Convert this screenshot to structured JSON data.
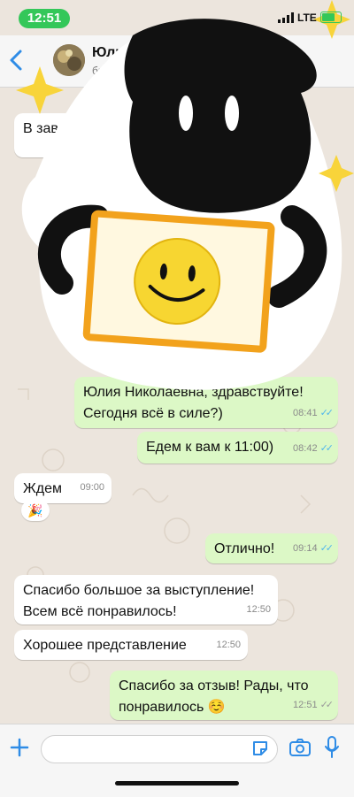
{
  "status_bar": {
    "time": "12:51",
    "network": "LTE"
  },
  "header": {
    "contact_name": "Юлия Н",
    "contact_status": "был(-а) се"
  },
  "messages": [
    {
      "side": "in",
      "text": "В зависимости о",
      "time": ""
    },
    {
      "side": "out",
      "text": "Юлия Николаевна, здравствуйте!",
      "text2": "Сегодня всё в силе?)",
      "time": "08:41"
    },
    {
      "side": "out",
      "text": "Едем к вам к 11:00)",
      "time": "08:42"
    },
    {
      "side": "in",
      "text": "Ждем",
      "time": "09:00"
    },
    {
      "side": "out",
      "text": "Отлично!",
      "time": "09:14"
    },
    {
      "side": "in",
      "text": "Спасибо большое за выступление!",
      "text2": "Всем всё понравилось!",
      "time": "12:50"
    },
    {
      "side": "in",
      "text": "Хорошее представление",
      "time": "12:50"
    },
    {
      "side": "out",
      "text": "Спасибо за отзыв! Рады, что",
      "text2": "понравилось ☺️",
      "time": "12:51"
    }
  ],
  "reaction_emoji": "🎉",
  "colors": {
    "out_bubble": "#dcf8c6",
    "in_bubble": "#ffffff",
    "accent": "#2f8ce6",
    "read_tick": "#4fb6ec"
  },
  "icons": [
    "back-chevron-icon",
    "plus-icon",
    "sticker-icon",
    "camera-icon",
    "microphone-icon",
    "smiley-sticker",
    "sparkle-icon"
  ]
}
